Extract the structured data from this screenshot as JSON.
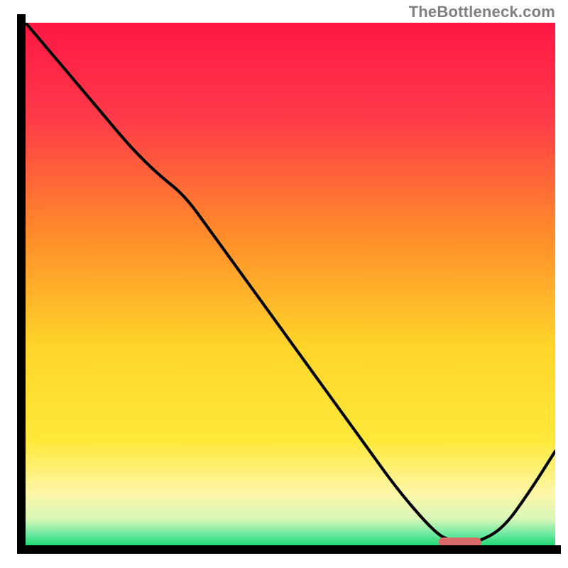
{
  "attribution": "TheBottleneck.com",
  "colors": {
    "gradient_top": "#ff1744",
    "gradient_mid1": "#ff9f2c",
    "gradient_mid2": "#ffea30",
    "gradient_low": "#fff7a8",
    "gradient_green": "#2ee87b",
    "curve": "#000000",
    "frame": "#000000",
    "flat_marker": "#d86a6a"
  },
  "chart_data": {
    "type": "line",
    "title": "",
    "xlabel": "",
    "ylabel": "",
    "xlim": [
      0,
      100
    ],
    "ylim": [
      0,
      100
    ],
    "x": [
      0,
      5,
      10,
      15,
      20,
      25,
      30,
      35,
      40,
      45,
      50,
      55,
      60,
      65,
      70,
      75,
      78,
      80,
      83,
      85,
      90,
      95,
      100
    ],
    "values": [
      100,
      94,
      88,
      82,
      76,
      71,
      67,
      60,
      53,
      46,
      39,
      32,
      25,
      18,
      11,
      5,
      2,
      1,
      0.5,
      0.5,
      3,
      10,
      18
    ],
    "flat_region_x": [
      78,
      86
    ],
    "flat_region_y": 0.6,
    "comment": "y is a qualitative bottleneck-style metric read off the curve; gradient colors are approximate hex values; x normalized 0-100, y normalized 0-100 from the inner plot area."
  }
}
